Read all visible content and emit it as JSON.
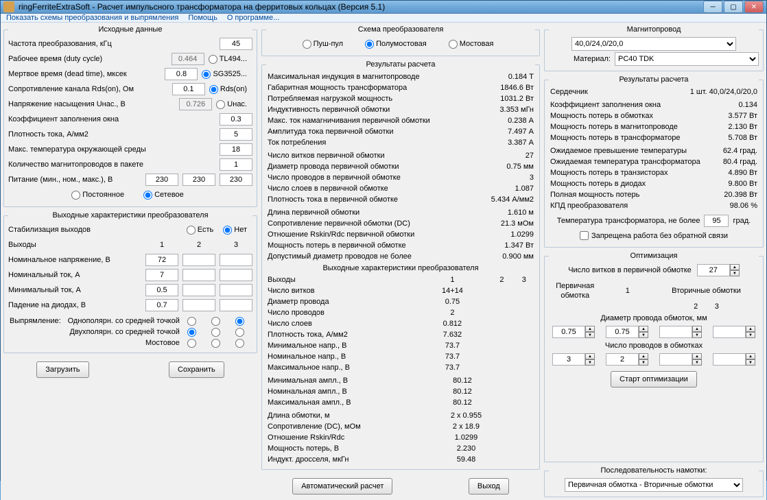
{
  "window": {
    "title": "ringFerriteExtraSoft - Расчет импульсного трансформатора на ферритовых кольцах (Версия 5.1)"
  },
  "menu": {
    "schemes": "Показать схемы преобразования и выпрямления",
    "help": "Помощь",
    "about": "О программе..."
  },
  "src": {
    "legend": "Исходные данные",
    "freq_l": "Частота преобразования, кГц",
    "freq": "45",
    "duty_l": "Рабочее время (duty cycle)",
    "duty": "0.464",
    "duty_r": "TL494...",
    "dead_l": "Мертвое время (dead time), мксек",
    "dead": "0.8",
    "dead_r": "SG3525...",
    "rds_l": "Сопротивление канала Rds(on), Ом",
    "rds": "0.1",
    "rds_r": "Rds(on)",
    "usat_l": "Напряжение насыщения Uнас., В",
    "usat": "0.726",
    "usat_r": "Uнас.",
    "kfill_l": "Коэффициент заполнения окна",
    "kfill": "0.3",
    "jdens_l": "Плотность тока, А/мм2",
    "jdens": "5",
    "tamb_l": "Макс. температура окружающей среды",
    "tamb": "18",
    "ncore_l": "Количество магнитопроводов  в пакете",
    "ncore": "1",
    "ps_l": "Питание (мин., ном., макс.), В",
    "ps_min": "230",
    "ps_nom": "230",
    "ps_max": "230",
    "ps_const": "Постоянное",
    "ps_ac": "Сетевое"
  },
  "out": {
    "legend": "Выходные характеристики преобразователя",
    "stab_l": "Стабилизация выходов",
    "stab_yes": "Есть",
    "stab_no": "Нет",
    "outputs_l": "Выходы",
    "c1": "1",
    "c2": "2",
    "c3": "3",
    "unom_l": "Номинальное напряжение, В",
    "unom": "72",
    "inom_l": "Номинальный ток, А",
    "inom": "7",
    "imin_l": "Минимальный ток, А",
    "imin": "0.5",
    "vdiode_l": "Падение на диодах, В",
    "vdiode": "0.7",
    "rect_l": "Выпрямление:",
    "rect1": "Однополярн. со средней точкой",
    "rect2": "Двухполярн. со средней точкой",
    "rect3": "Мостовое"
  },
  "scheme": {
    "legend": "Схема преобразователя",
    "pp": "Пуш-пул",
    "hb": "Полумостовая",
    "fb": "Мостовая"
  },
  "res": {
    "legend": "Результаты расчета",
    "bmax_l": "Максимальная индукция в магнитопроводе",
    "bmax": "0.184 Т",
    "pgab_l": "Габаритная мощность трансформатора",
    "pgab": "1846.6 Вт",
    "pload_l": "Потребляемая нагрузкой мощность",
    "pload": "1031.2 Вт",
    "lprim_l": "Индуктивность первичной обмотки",
    "lprim": "3.353 мГн",
    "imag_l": "Макс. ток намагничивания первичной обмотки",
    "imag": "0.238 А",
    "iamp_l": "Амплитуда тока первичной обмотки",
    "iamp": "7.497 А",
    "icon_l": "Ток потребления",
    "icon": "3.387 А",
    "n1_l": "Число витков первичной обмотки",
    "n1": "27",
    "d1_l": "Диаметр провода первичной обмотки",
    "d1": "0.75 мм",
    "nw1_l": "Число проводов  в первичной обмотке",
    "nw1": "3",
    "nl1_l": "Число слоев  в первичной обмотке",
    "nl1": "1.087",
    "j1_l": "Плотность тока в первичной обмотке",
    "j1": "5.434 А/мм2",
    "len1_l": "Длина  первичной обмотки",
    "len1": "1.610 м",
    "r1_l": "Сопротивление первичной обмотки (DC)",
    "r1": "21.3 мОм",
    "rskin1_l": "Отношение Rskin/Rdc первичной обмотки",
    "rskin1": "1.0299",
    "p1_l": "Мощность потерь в первичной обмотке",
    "p1": "1.347 Вт",
    "dmax1_l": "Допустимый диаметр проводов не более",
    "dmax1": "0.900 мм",
    "sect2": "Выходные характеристики преобразователя",
    "hdr_out": "Выходы",
    "hdr1": "1",
    "hdr2": "2",
    "hdr3": "3",
    "n2_l": "Число витков",
    "n2": "14+14",
    "d2_l": "Диаметр провода",
    "d2": "0.75",
    "nw2_l": "Число проводов",
    "nw2": "2",
    "nl2_l": "Число слоев",
    "nl2": "0.812",
    "j2_l": "Плотность тока, А/мм2",
    "j2": "7.632",
    "umin_l": "Минимальное напр., В",
    "umin": "73.7",
    "unom2_l": "Номинальное напр., В",
    "unom2": "73.7",
    "umax_l": "Максимальное напр., В",
    "umax": "73.7",
    "amin_l": "Минимальная ампл., В",
    "amin": "80.12",
    "anom_l": "Номинальная ампл., В",
    "anom": "80.12",
    "amax_l": "Максимальная ампл., В",
    "amax": "80.12",
    "len2_l": "Длина обмотки, м",
    "len2": "2 x 0.955",
    "r2_l": "Сопротивление (DC), мОм",
    "r2": "2 x 18.9",
    "rskin2_l": "Отношение Rskin/Rdc",
    "rskin2": "1.0299",
    "p2_l": "Мощность потерь, В",
    "p2": "2.230",
    "lchoke_l": "Индукт. дросселя, мкГн",
    "lchoke": "59.48"
  },
  "core": {
    "legend": "Магнитопровод",
    "size": "40,0/24,0/20,0",
    "mat_l": "Материал:",
    "mat": "PC40 TDK"
  },
  "res2": {
    "legend": "Результаты расчета",
    "core_l": "Сердечник",
    "core": "1 шт.  40,0/24,0/20,0",
    "kfill_l": "Коэффициент заполнения окна",
    "kfill": "0.134",
    "pw_l": "Мощность потерь в обмотках",
    "pw": "3.577 Вт",
    "pm_l": "Мощность потерь в магнитопроводе",
    "pm": "2.130 Вт",
    "pt_l": "Мощность потерь в трансформаторе",
    "pt": "5.708 Вт",
    "dt_l": "Ожидаемое превышение температуры",
    "dt": "62.4 град.",
    "ttr_l": "Ожидаемая температура трансформатора",
    "ttr": "80.4 град.",
    "ptr_l": "Мощность потерь в транзисторах",
    "ptr": "4.890 Вт",
    "pd_l": "Мощность потерь в диодах",
    "pd": "9.800 Вт",
    "ptot_l": "Полная мощность потерь",
    "ptot": "20.398 Вт",
    "eff_l": "КПД преобразователя",
    "eff": "98.06 %",
    "tmax_l": "Температура трансформатора, не более",
    "tmax": "95",
    "tmax_u": "град.",
    "nofb": "Запрещена работа без обратной связи"
  },
  "opt": {
    "legend": "Оптимизация",
    "n1_l": "Число витков в первичной обмотке",
    "n1": "27",
    "prim": "Первичная обмотка",
    "sec": "Вторичные обмотки",
    "c1": "1",
    "c2": "2",
    "c3": "3",
    "diam_l": "Диаметр провода обмоток, мм",
    "d1": "0.75",
    "d2": "0.75",
    "nwires_l": "Число проводов в обмотках",
    "nw1": "3",
    "nw2": "2",
    "start": "Старт оптимизации",
    "seq_l": "Последовательность намотки:",
    "seq": "Первичная обмотка - Вторичные обмотки"
  },
  "btns": {
    "load": "Загрузить",
    "save": "Сохранить",
    "auto": "Автоматический расчет",
    "exit": "Выход"
  }
}
